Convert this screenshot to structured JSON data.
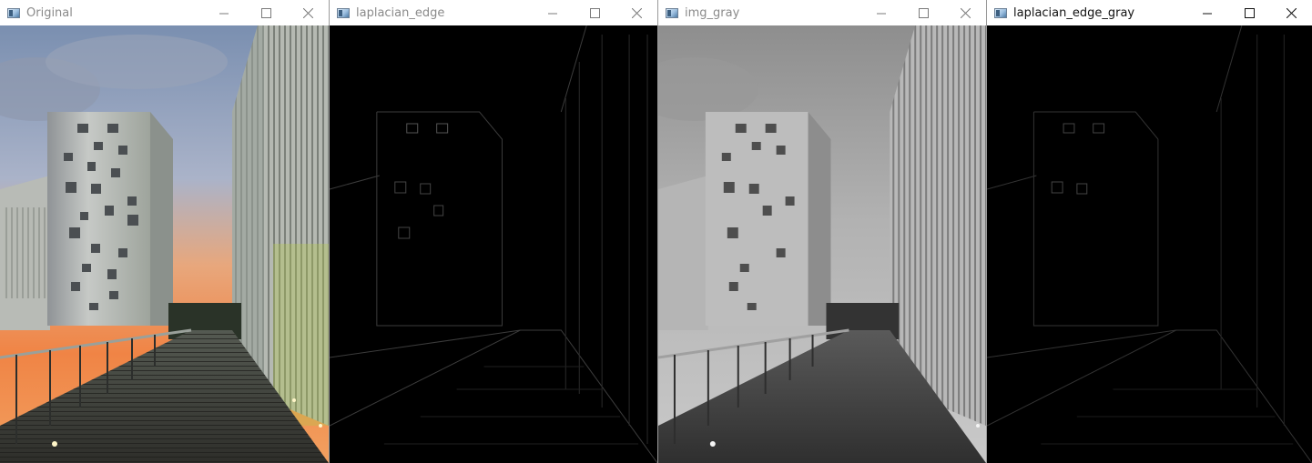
{
  "windows": [
    {
      "title": "Original",
      "active": false,
      "image": "color-scene"
    },
    {
      "title": "laplacian_edge",
      "active": false,
      "image": "edge-map"
    },
    {
      "title": "img_gray",
      "active": false,
      "image": "gray-scene"
    },
    {
      "title": "laplacian_edge_gray",
      "active": true,
      "image": "edge-map-gray"
    }
  ],
  "controls": {
    "minimize": "minimize-icon",
    "maximize": "maximize-icon",
    "close": "close-icon"
  }
}
